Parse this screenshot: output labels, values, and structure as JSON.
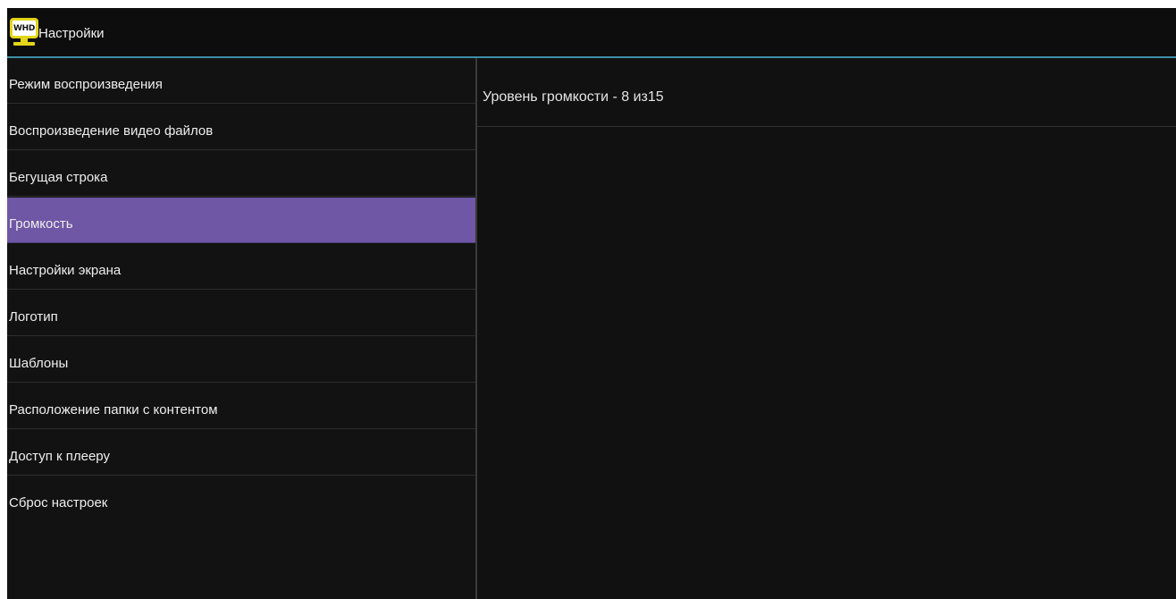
{
  "header": {
    "logo_text": "WHD",
    "title": "Настройки",
    "accent_color": "#3f8fa6",
    "logo_color": "#e3d519"
  },
  "sidebar": {
    "selected_index": 3,
    "selected_color": "#6f57a5",
    "items": [
      {
        "label": "Режим воспроизведения"
      },
      {
        "label": "Воспроизведение видео файлов"
      },
      {
        "label": "Бегущая строка"
      },
      {
        "label": "Громкость"
      },
      {
        "label": "Настройки экрана"
      },
      {
        "label": "Логотип"
      },
      {
        "label": "Шаблоны"
      },
      {
        "label": "Расположение папки с контентом"
      },
      {
        "label": "Доступ к плееру"
      },
      {
        "label": "Сброс настроек"
      }
    ]
  },
  "content": {
    "volume_label": "Уровень громкости - 8 из15"
  }
}
